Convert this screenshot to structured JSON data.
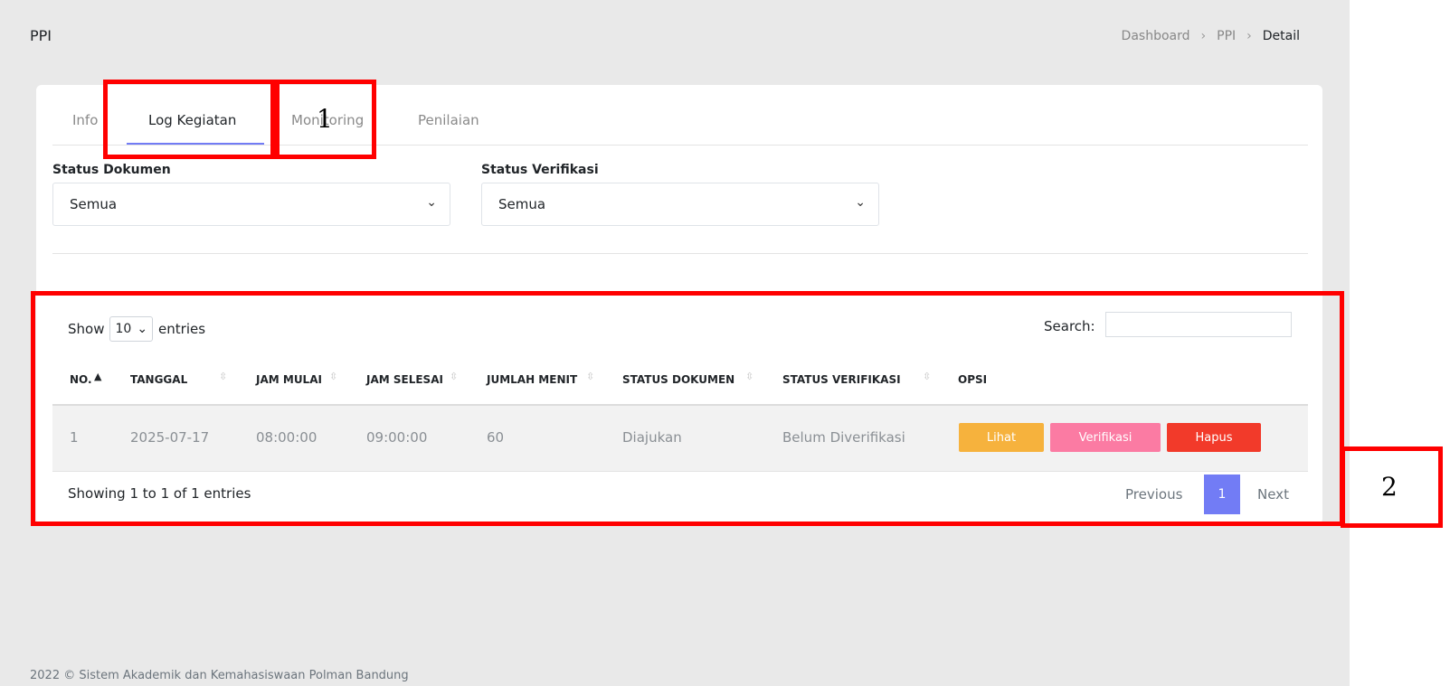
{
  "page": {
    "title": "PPI"
  },
  "breadcrumb": [
    "Dashboard",
    "PPI",
    "Detail"
  ],
  "tabs": [
    {
      "label": "Info",
      "active": false
    },
    {
      "label": "Log Kegiatan",
      "active": true
    },
    {
      "label": "Monitoring",
      "active": false
    },
    {
      "label": "Penilaian",
      "active": false
    }
  ],
  "filters": {
    "status_dokumen": {
      "label": "Status Dokumen",
      "value": "Semua"
    },
    "status_verifikasi": {
      "label": "Status Verifikasi",
      "value": "Semua"
    }
  },
  "table_controls": {
    "show_label": "Show",
    "entries_value": "10",
    "entries_label": "entries",
    "search_label": "Search:",
    "search_value": ""
  },
  "table": {
    "columns": [
      "NO.",
      "TANGGAL",
      "JAM MULAI",
      "JAM SELESAI",
      "JUMLAH MENIT",
      "STATUS DOKUMEN",
      "STATUS VERIFIKASI",
      "OPSI"
    ],
    "rows": [
      {
        "no": "1",
        "tanggal": "2025-07-17",
        "jam_mulai": "08:00:00",
        "jam_selesai": "09:00:00",
        "jumlah_menit": "60",
        "status_dokumen": "Diajukan",
        "status_verifikasi": "Belum Diverifikasi",
        "actions": [
          "Lihat",
          "Verifikasi",
          "Hapus"
        ]
      }
    ]
  },
  "pagination": {
    "info": "Showing 1 to 1 of 1 entries",
    "previous": "Previous",
    "current": "1",
    "next": "Next"
  },
  "footer": "2022 © Sistem Akademik dan Kemahasiswaan Polman Bandung",
  "annotations": [
    "1",
    "2"
  ],
  "colors": {
    "accent": "#727cf5",
    "btn_lihat": "#f6b23d",
    "btn_verifikasi": "#fb7ba3",
    "btn_hapus": "#f23a2a",
    "annotation": "#ff0000"
  }
}
